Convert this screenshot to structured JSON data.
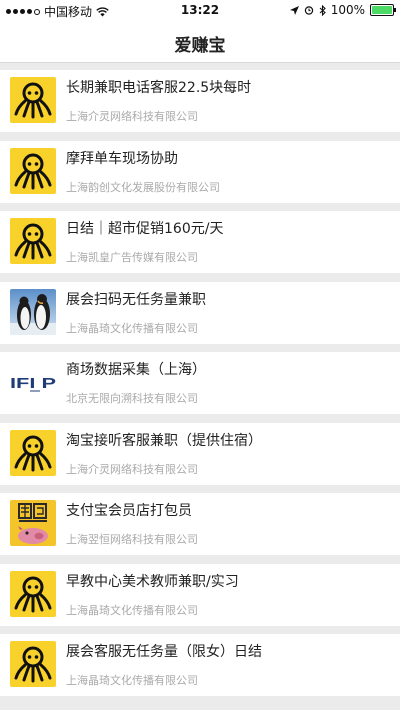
{
  "status_bar": {
    "carrier": "中国移动",
    "time": "13:22",
    "battery": "100%"
  },
  "nav": {
    "title": "爱赚宝"
  },
  "jobs": [
    {
      "title": "长期兼职电话客服22.5块每时",
      "company": "上海介灵网络科技有限公司",
      "icon": "octopus-logo"
    },
    {
      "title": "摩拜单车现场协助",
      "company": "上海韵创文化发展股份有限公司",
      "icon": "octopus-logo"
    },
    {
      "title": "日结｜超市促销160元/天",
      "company": "上海凯皇广告传媒有限公司",
      "icon": "octopus-logo"
    },
    {
      "title": "展会扫码无任务量兼职",
      "company": "上海晶琦文化传播有限公司",
      "icon": "penguin-photo"
    },
    {
      "title": "商场数据采集（上海）",
      "company": "北京无限向溯科技有限公司",
      "icon": "ifip-logo",
      "logo_text": "IFI P"
    },
    {
      "title": "淘宝接听客服兼职（提供住宿）",
      "company": "上海介灵网络科技有限公司",
      "icon": "octopus-logo"
    },
    {
      "title": "支付宝会员店打包员",
      "company": "上海翌恒网络科技有限公司",
      "icon": "pig-logo"
    },
    {
      "title": "早教中心美术教师兼职/实习",
      "company": "上海晶琦文化传播有限公司",
      "icon": "octopus-logo"
    },
    {
      "title": "展会客服无任务量（限女）日结",
      "company": "上海晶琦文化传播有限公司",
      "icon": "octopus-logo"
    }
  ],
  "colors": {
    "octopus_bg": "#f9d12b",
    "page_bg": "#ebebeb",
    "title_text": "#222222",
    "company_text": "#aaaaaa"
  }
}
